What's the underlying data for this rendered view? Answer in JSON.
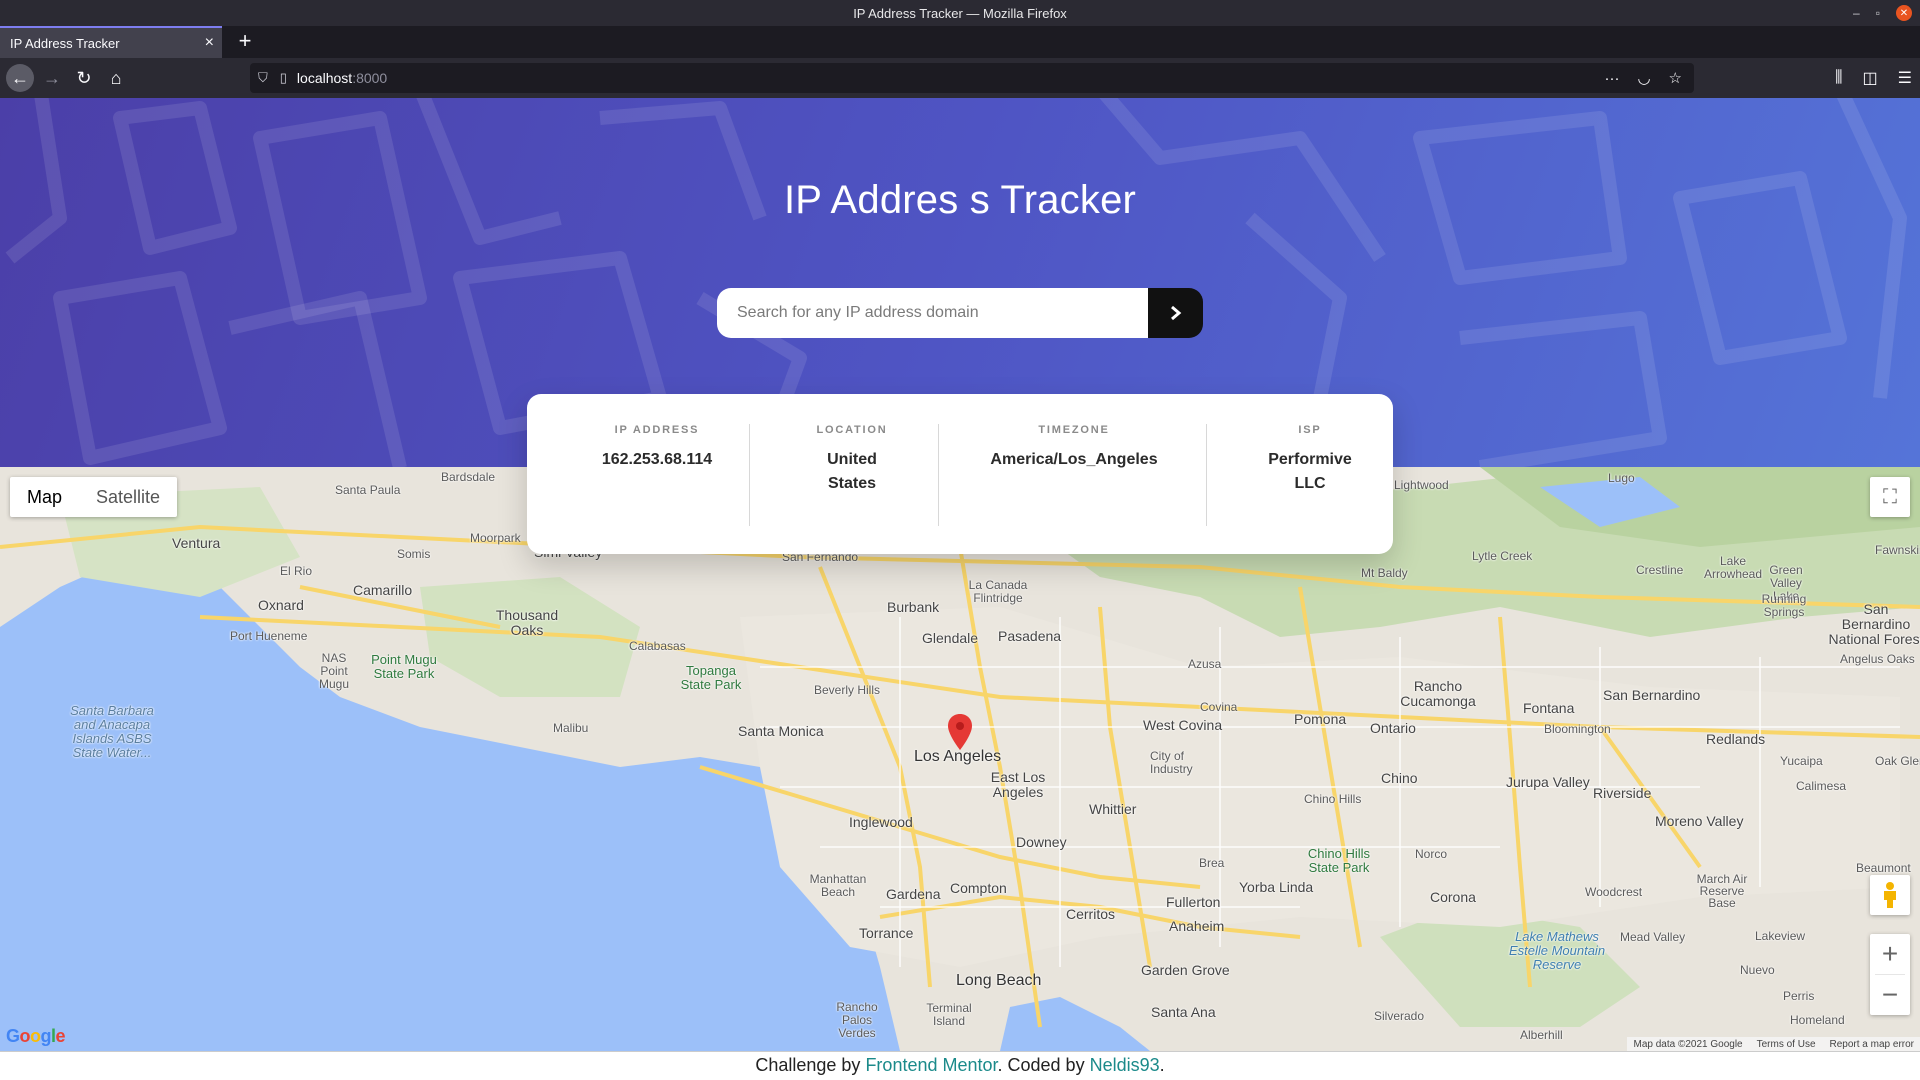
{
  "window": {
    "title": "IP Address Tracker — Mozilla Firefox"
  },
  "tab": {
    "title": "IP Address Tracker"
  },
  "urlbar": {
    "host": "localhost",
    "port": ":8000"
  },
  "header": {
    "title": "IP Addres s Tracker",
    "search_placeholder": "Search for any IP address domain"
  },
  "info": {
    "ip_label": "IP ADDRESS",
    "ip_value": "162.253.68.114",
    "location_label": "LOCATION",
    "location_value": "United States",
    "timezone_label": "TIMEZONE",
    "timezone_value": "America/Los_Angeles",
    "isp_label": "ISP",
    "isp_value": "Performive LLC"
  },
  "map": {
    "type_map": "Map",
    "type_satellite": "Satellite",
    "attribution": {
      "map_data": "Map data ©2021 Google",
      "terms": "Terms of Use",
      "report": "Report a map error"
    },
    "labels": [
      "Santa Paula",
      "Bardsdale",
      "Moorpark",
      "Simi Valley",
      "Ventura",
      "Somis",
      "El Rio",
      "Oxnard",
      "Camarillo",
      "Thousand Oaks",
      "Port Hueneme",
      "Calabasas",
      "NAS Point Mugu",
      "Point Mugu State Park",
      "Topanga State Park",
      "Santa Barbara and Anacapa Islands ASBS State Water...",
      "Malibu",
      "Santa Monica",
      "Beverly Hills",
      "Burbank",
      "Glendale",
      "Pasadena",
      "La Canada Flintridge",
      "Los Angeles",
      "East Los Angeles",
      "Inglewood",
      "Downey",
      "Manhattan Beach",
      "Gardena",
      "Compton",
      "Torrance",
      "Cerritos",
      "Long Beach",
      "Rancho Palos Verdes",
      "Terminal Island",
      "West Covina",
      "Covina",
      "Azusa",
      "City of Industry",
      "Whittier",
      "Pomona",
      "Ontario",
      "Chino",
      "Chino Hills",
      "Rancho Cucamonga",
      "Fontana",
      "Bloomington",
      "San Bernardino",
      "Redlands",
      "Yucaipa",
      "Jurupa Valley",
      "Riverside",
      "Moreno Valley",
      "Brea",
      "Yorba Linda",
      "Fullerton",
      "Anaheim",
      "Garden Grove",
      "Santa Ana",
      "Corona",
      "Norco",
      "Chino Hills State Park",
      "Woodcrest",
      "March Air Reserve Base",
      "Mead Valley",
      "Lake Mathews Estelle Mountain Reserve",
      "Lakeview",
      "Nuevo",
      "Perris",
      "Homeland",
      "Silverado",
      "Alberhill",
      "Lugo",
      "Lytle Creek",
      "Mt Baldy",
      "Crestline",
      "Lake Arrowhead",
      "Green Valley Lake",
      "Running Springs",
      "San Bernardino National Forest",
      "Angelus Oaks",
      "Fawnskin",
      "Calimesa",
      "Oak Glen",
      "Beaumont",
      "Lightwood",
      "San Fernando"
    ]
  },
  "footer": {
    "prefix": "Challenge by ",
    "link1": "Frontend Mentor",
    "middle": ". Coded by ",
    "link2": "Neldis93",
    "suffix": "."
  },
  "colors": {
    "hero_start": "#4b3fa8",
    "hero_end": "#5574d8",
    "search_button": "#111111",
    "footer_link": "#1b8a8a",
    "marker": "#e53935"
  }
}
